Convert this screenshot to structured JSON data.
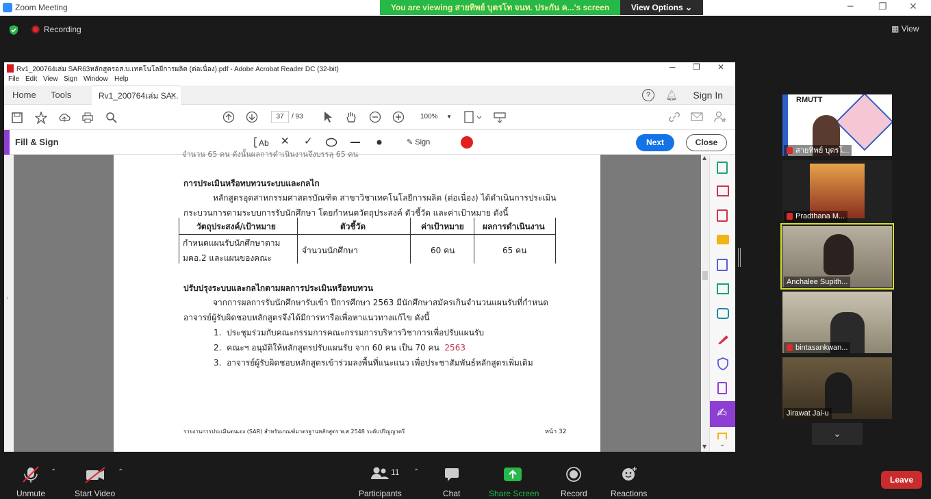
{
  "zoom": {
    "title": "Zoom Meeting",
    "banner": "You are viewing สายทิพย์  บุตรโท  จนท. ประกัน ค...'s screen",
    "view_options": "View Options",
    "recording": "Recording",
    "view": "View"
  },
  "acrobat": {
    "title": "Rv1_200764เล่ม SAR63หลักสูตรอส.บ.เทคโนโลยีการผลิต (ต่อเนื่อง).pdf - Adobe Acrobat Reader DC (32-bit)",
    "menu": [
      "File",
      "Edit",
      "View",
      "Sign",
      "Window",
      "Help"
    ],
    "tabs": {
      "home": "Home",
      "tools": "Tools",
      "doc": "Rv1_200764เล่ม SA..."
    },
    "sign_in": "Sign In",
    "page_current": "37",
    "page_total": "/ 93",
    "zoom_level": "100%",
    "fill_sign": "Fill & Sign",
    "sign": "Sign",
    "next": "Next",
    "close": "Close"
  },
  "document": {
    "top_cut": "จำนวน 65 คน ดังนั้นผลการดำเนินงานจึงบรรลุ 65 คน",
    "heading1": "การประเมินหรือทบทวนระบบและกลไก",
    "para1_line1": "หลักสูตรอุตสาหกรรมศาสตรบัณฑิต  สาขาวิชาเทคโนโลยีการผลิต  (ต่อเนื่อง) ได้ดำเนินการประเมิน",
    "para1_line2": "กระบวนการตามระบบการรับนักศึกษา โดยกำหนดวัตถุประสงค์ ตัวชี้วัด และค่าเป้าหมาย ดังนี้",
    "table_headers": [
      "วัตถุประสงค์/เป้าหมาย",
      "ตัวชี้วัด",
      "ค่าเป้าหมาย",
      "ผลการดำเนินงาน"
    ],
    "row_obj_line1": "กำหนดแผนรับนักศึกษาตาม",
    "row_obj_line2": "มคอ.2 และแผนของคณะ",
    "row_indicator": "จำนวนนักศึกษา",
    "row_target": "60 คน",
    "row_result": "65 คน",
    "heading2": "ปรับปรุงระบบและกลไกตามผลการประเมินหรือทบทวน",
    "para2_line1": "จากการผลการรับนักศึกษารับเข้า ปีการศึกษา 2563 มีนักศึกษาสมัครเกินจำนวนแผนรับที่กำหนด",
    "para2_line2": "อาจารย์ผู้รับผิดชอบหลักสูตรจึงได้มีการหารือเพื่อหาแนวทางแก้ไข ดังนี้",
    "items": [
      {
        "num": "1.",
        "text": "ประชุมร่วมกับคณะกรรมการคณะกรรมการบริหารวิชาการเพื่อปรับแผนรับ"
      },
      {
        "num": "2.",
        "text": "คณะฯ อนุมัติให้หลักสูตรปรับแผนรับ จาก 60 คน เป็น 70 คน"
      },
      {
        "num": "3.",
        "text": "อาจารย์ผู้รับผิดชอบหลักสูตรเข้าร่วมลงพื้นที่แนะแนว เพื่อประชาสัมพันธ์หลักสูตรเพิ่มเติม"
      }
    ],
    "item2_year": "2563",
    "footer": "รายงานการประเมินตนเอง (SAR) สำหรับเกณฑ์มาตรฐานหลักสูตร พ.ศ.2548  ระดับปริญญาตรี",
    "page_label": "หน้า 32"
  },
  "participants_gallery": [
    {
      "name": "สายทิพย์  บุตรโ..."
    },
    {
      "name": "Pradthana M..."
    },
    {
      "name": "Anchalee Supith..."
    },
    {
      "name": "bintasankwan..."
    },
    {
      "name": "Jirawat Jai-u"
    }
  ],
  "logo_text": "RMUTT",
  "toolbar": {
    "unmute": "Unmute",
    "start_video": "Start Video",
    "participants": "Participants",
    "participant_count": "11",
    "chat": "Chat",
    "share": "Share Screen",
    "record": "Record",
    "reactions": "Reactions",
    "leave": "Leave"
  },
  "colors": {
    "share_green": "#26b849",
    "leave_red": "#c92c2c",
    "acrobat_blue": "#1473e6",
    "fill_sign_purple": "#8e3fd3",
    "active_speaker": "#d6e02e"
  }
}
